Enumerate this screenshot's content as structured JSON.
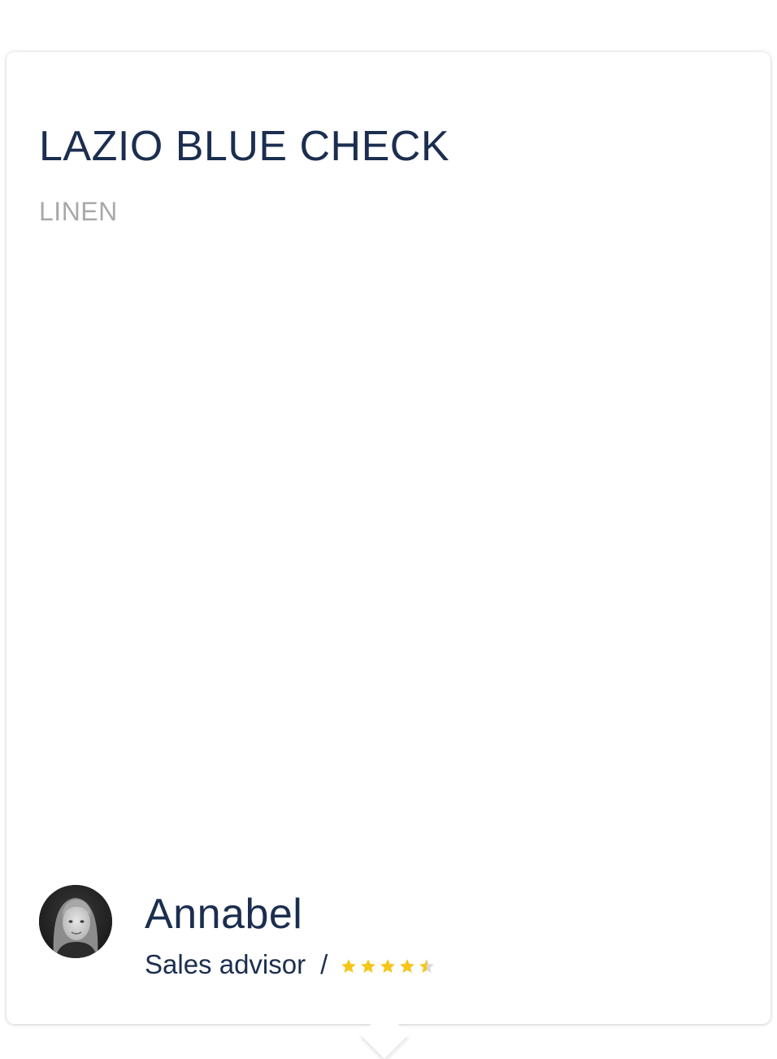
{
  "product": {
    "title": "LAZIO BLUE CHECK",
    "material": "LINEN"
  },
  "advisor": {
    "name": "Annabel",
    "role": "Sales advisor",
    "separator": "/",
    "rating": 4.5,
    "rating_max": 5,
    "avatar_icon": "advisor-portrait"
  },
  "colors": {
    "text_primary": "#1b2e4f",
    "text_muted": "#a9a9a9",
    "star_filled": "#f5c518",
    "star_empty": "#d9d9d9"
  }
}
